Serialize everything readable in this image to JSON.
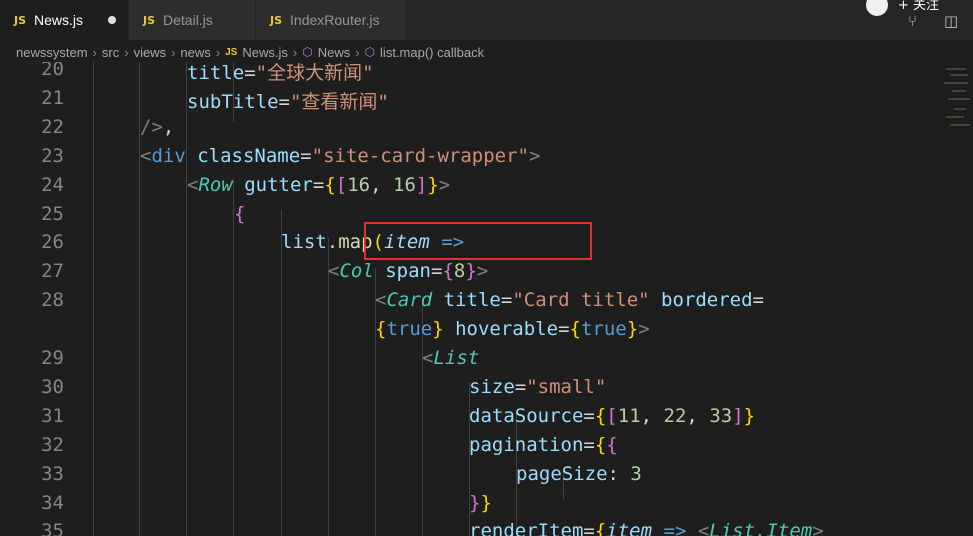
{
  "tabs": [
    {
      "label": "News.js",
      "type": "JS",
      "active": true,
      "modified": true
    },
    {
      "label": "Detail.js",
      "type": "JS",
      "active": false,
      "modified": false
    },
    {
      "label": "IndexRouter.js",
      "type": "JS",
      "active": false,
      "modified": false
    }
  ],
  "follow_label": "+ 关注",
  "breadcrumb": {
    "items": [
      "newssystem",
      "src",
      "views",
      "news"
    ],
    "file": "News.js",
    "file_type": "JS",
    "symbol1": "News",
    "symbol2": "list.map() callback"
  },
  "editor": {
    "lines": [
      {
        "num": "20",
        "code": [
          [
            "t-attr",
            "title"
          ],
          [
            "",
            "="
          ],
          [
            "t-str",
            "\"全球大新闻\""
          ]
        ]
      },
      {
        "num": "21",
        "code": [
          [
            "t-attr",
            "subTitle"
          ],
          [
            "",
            "="
          ],
          [
            "t-str",
            "\"查看新闻\""
          ]
        ]
      },
      {
        "num": "22",
        "code": [
          [
            "t-gray",
            "/>"
          ],
          [
            "",
            ","
          ]
        ]
      },
      {
        "num": "23",
        "code": [
          [
            "t-gray",
            "<"
          ],
          [
            "t-tag",
            "div"
          ],
          [
            "",
            ""
          ],
          [
            "t-attr",
            " className"
          ],
          [
            "",
            "="
          ],
          [
            "t-str",
            "\"site-card-wrapper\""
          ],
          [
            "t-gray",
            ">"
          ]
        ]
      },
      {
        "num": "24",
        "code": [
          [
            "t-gray",
            "<"
          ],
          [
            "t-comp",
            "Row"
          ],
          [
            "t-attr",
            " gutter"
          ],
          [
            "",
            "="
          ],
          [
            "t-yel",
            "{"
          ],
          [
            "t-pink",
            "["
          ],
          [
            "t-num",
            "16"
          ],
          [
            "",
            ", "
          ],
          [
            "t-num",
            "16"
          ],
          [
            "t-pink",
            "]"
          ],
          [
            "t-yel",
            "}"
          ],
          [
            "t-gray",
            ">"
          ]
        ]
      },
      {
        "num": "25",
        "code": [
          [
            "t-pink",
            "{"
          ]
        ]
      },
      {
        "num": "26",
        "code": [
          [
            "t-attr",
            "list"
          ],
          [
            "",
            "."
          ],
          [
            "t-fn",
            "map"
          ],
          [
            "t-yel",
            "("
          ],
          [
            "t-param",
            "item"
          ],
          [
            "t-kw",
            " =>"
          ]
        ]
      },
      {
        "num": "27",
        "code": [
          [
            "t-gray",
            "<"
          ],
          [
            "t-comp",
            "Col"
          ],
          [
            "t-attr",
            " span"
          ],
          [
            "",
            "="
          ],
          [
            "t-pink",
            "{"
          ],
          [
            "t-num",
            "8"
          ],
          [
            "t-pink",
            "}"
          ],
          [
            "t-gray",
            ">"
          ]
        ]
      },
      {
        "num": "28",
        "code": [
          [
            "t-gray",
            "<"
          ],
          [
            "t-comp",
            "Card"
          ],
          [
            "t-attr",
            " title"
          ],
          [
            "",
            "="
          ],
          [
            "t-str",
            "\"Card title\""
          ],
          [
            "t-attr",
            " bordered"
          ],
          [
            "",
            "="
          ]
        ]
      },
      {
        "num": "",
        "code": [
          [
            "t-yel",
            "{"
          ],
          [
            "t-kw",
            "true"
          ],
          [
            "t-yel",
            "}"
          ],
          [
            "t-attr",
            " hoverable"
          ],
          [
            "",
            "="
          ],
          [
            "t-yel",
            "{"
          ],
          [
            "t-kw",
            "true"
          ],
          [
            "t-yel",
            "}"
          ],
          [
            "t-gray",
            ">"
          ]
        ]
      },
      {
        "num": "29",
        "code": [
          [
            "t-gray",
            "<"
          ],
          [
            "t-comp",
            "List"
          ]
        ]
      },
      {
        "num": "30",
        "code": [
          [
            "t-attr",
            "size"
          ],
          [
            "",
            "="
          ],
          [
            "t-str",
            "\"small\""
          ]
        ]
      },
      {
        "num": "31",
        "code": [
          [
            "t-attr",
            "dataSource"
          ],
          [
            "",
            "="
          ],
          [
            "t-yel",
            "{"
          ],
          [
            "t-pink",
            "["
          ],
          [
            "t-num",
            "11"
          ],
          [
            "",
            ", "
          ],
          [
            "t-num",
            "22"
          ],
          [
            "",
            ", "
          ],
          [
            "t-num",
            "33"
          ],
          [
            "t-pink",
            "]"
          ],
          [
            "t-yel",
            "}"
          ]
        ]
      },
      {
        "num": "32",
        "code": [
          [
            "t-attr",
            "pagination"
          ],
          [
            "",
            "="
          ],
          [
            "t-yel",
            "{"
          ],
          [
            "t-pink",
            "{"
          ]
        ]
      },
      {
        "num": "33",
        "code": [
          [
            "t-attr",
            "pageSize"
          ],
          [
            "",
            ": "
          ],
          [
            "t-num",
            "3"
          ]
        ]
      },
      {
        "num": "34",
        "code": [
          [
            "t-pink",
            "}"
          ],
          [
            "t-yel",
            "}"
          ]
        ]
      },
      {
        "num": "35",
        "code": [
          [
            "t-attr",
            "renderItem"
          ],
          [
            "",
            "="
          ],
          [
            "t-yel",
            "{"
          ],
          [
            "t-param",
            "item"
          ],
          [
            "t-kw",
            " =>"
          ],
          [
            "t-gray",
            " <"
          ],
          [
            "t-comp",
            "List.Item"
          ],
          [
            "t-gray",
            ">"
          ]
        ]
      }
    ]
  },
  "colors": {
    "editor_bg": "#1e1e1e",
    "tab_bar_bg": "#252526",
    "highlight_box": "#e03232"
  }
}
